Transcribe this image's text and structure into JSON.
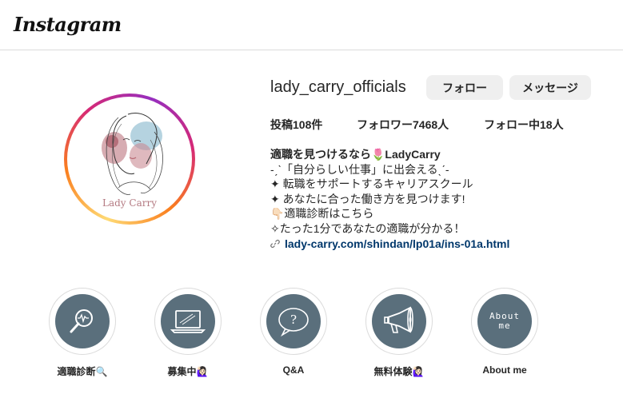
{
  "header": {
    "logo_text": "Instagram"
  },
  "profile": {
    "username": "lady_carry_officials",
    "avatar_caption": "Lady Carry",
    "follow_label": "フォロー",
    "message_label": "メッセージ",
    "stats": {
      "posts": "投稿108件",
      "followers": "フォロワー7468人",
      "following": "フォロー中18人"
    },
    "bio": {
      "name": "適職を見つけるなら🌷LadyCarry",
      "lines": [
        "-ˏˋ「自分らしい仕事」に出会えるˎˊ-",
        "✦ 転職をサポートするキャリアスクール",
        "✦ あなたに合った働き方を見つけます!",
        "👇🏻適職診断はこちら",
        "✧たった1分であなたの適職が分かる！"
      ],
      "link": "lady-carry.com/shindan/lp01a/ins-01a.html"
    }
  },
  "highlights": [
    {
      "label": "適職診断🔍",
      "icon": "magnifier-icon"
    },
    {
      "label": "募集中🙋🏻‍♀️",
      "icon": "laptop-icon"
    },
    {
      "label": "Q&A",
      "icon": "question-bubble-icon"
    },
    {
      "label": "無料体験🙋🏻‍♀️",
      "icon": "megaphone-icon"
    },
    {
      "label": "About me",
      "icon": "about-me-text",
      "text": "About me"
    }
  ],
  "colors": {
    "highlight_bg": "#5a6f7c",
    "button_bg": "#efefef",
    "link": "#00376b"
  }
}
